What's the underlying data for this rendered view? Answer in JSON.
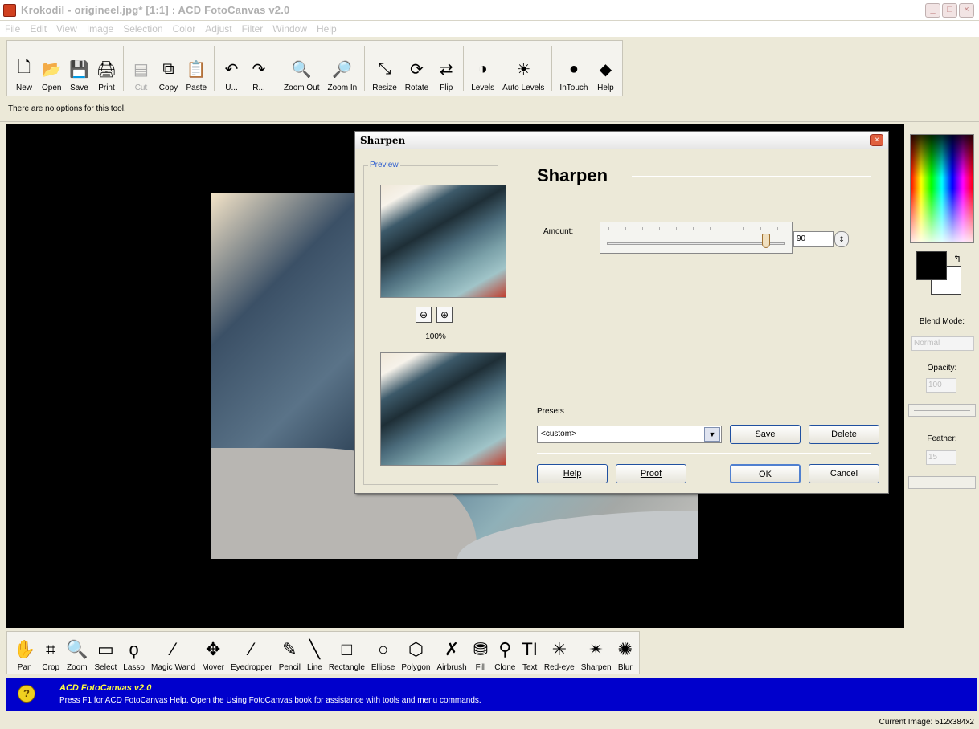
{
  "window": {
    "title": "Krokodil - origineel.jpg* [1:1] : ACD FotoCanvas v2.0",
    "buttons": [
      "_",
      "□",
      "×"
    ]
  },
  "menu": [
    "File",
    "Edit",
    "View",
    "Image",
    "Selection",
    "Color",
    "Adjust",
    "Filter",
    "Window",
    "Help"
  ],
  "toolbar": {
    "groups": [
      [
        {
          "label": "New",
          "icon": "new-file-icon",
          "glyph": "🗋",
          "disabled": false
        },
        {
          "label": "Open",
          "icon": "open-folder-icon",
          "glyph": "📂",
          "disabled": false
        },
        {
          "label": "Save",
          "icon": "save-disk-icon",
          "glyph": "💾",
          "disabled": false
        },
        {
          "label": "Print",
          "icon": "printer-icon",
          "glyph": "🖨",
          "disabled": false
        }
      ],
      [
        {
          "label": "Cut",
          "icon": "cut-icon",
          "glyph": "▤",
          "disabled": true
        },
        {
          "label": "Copy",
          "icon": "copy-icon",
          "glyph": "⧉",
          "disabled": false
        },
        {
          "label": "Paste",
          "icon": "paste-icon",
          "glyph": "📋",
          "disabled": false
        }
      ],
      [
        {
          "label": "U...",
          "icon": "undo-icon",
          "glyph": "↶",
          "disabled": false
        },
        {
          "label": "R...",
          "icon": "redo-icon",
          "glyph": "↷",
          "disabled": false
        }
      ],
      [
        {
          "label": "Zoom Out",
          "icon": "zoom-out-icon",
          "glyph": "🔍",
          "disabled": false
        },
        {
          "label": "Zoom In",
          "icon": "zoom-in-icon",
          "glyph": "🔎",
          "disabled": false
        }
      ],
      [
        {
          "label": "Resize",
          "icon": "resize-icon",
          "glyph": "⤡",
          "disabled": false
        },
        {
          "label": "Rotate",
          "icon": "rotate-icon",
          "glyph": "⟳",
          "disabled": false
        },
        {
          "label": "Flip",
          "icon": "flip-icon",
          "glyph": "⇄",
          "disabled": false
        }
      ],
      [
        {
          "label": "Levels",
          "icon": "levels-icon",
          "glyph": "◑",
          "disabled": false
        },
        {
          "label": "Auto Levels",
          "icon": "auto-levels-icon",
          "glyph": "☀",
          "disabled": false
        }
      ],
      [
        {
          "label": "InTouch",
          "icon": "intouch-icon",
          "glyph": "●",
          "disabled": false
        },
        {
          "label": "Help",
          "icon": "help-icon",
          "glyph": "◆",
          "disabled": false
        }
      ]
    ]
  },
  "options_text": "There are no options for this tool.",
  "right_panel": {
    "blend_mode_label": "Blend Mode:",
    "blend_mode_value": "Normal",
    "opacity_label": "Opacity:",
    "opacity_value": "100",
    "feather_label": "Feather:",
    "feather_value": "15"
  },
  "tools": [
    {
      "label": "Pan",
      "icon": "hand-pan-icon",
      "glyph": "✋"
    },
    {
      "label": "Crop",
      "icon": "crop-icon",
      "glyph": "⌗"
    },
    {
      "label": "Zoom",
      "icon": "zoom-tool-icon",
      "glyph": "🔍"
    },
    {
      "label": "Select",
      "icon": "select-rectangle-icon",
      "glyph": "▭"
    },
    {
      "label": "Lasso",
      "icon": "lasso-icon",
      "glyph": "ϙ"
    },
    {
      "label": "Magic Wand",
      "icon": "magic-wand-icon",
      "glyph": "⁄"
    },
    {
      "label": "Mover",
      "icon": "mover-arrows-icon",
      "glyph": "✥"
    },
    {
      "label": "Eyedropper",
      "icon": "eyedropper-icon",
      "glyph": "⁄"
    },
    {
      "label": "Pencil",
      "icon": "pencil-icon",
      "glyph": "✎"
    },
    {
      "label": "Line",
      "icon": "line-icon",
      "glyph": "╲"
    },
    {
      "label": "Rectangle",
      "icon": "rectangle-icon",
      "glyph": "□"
    },
    {
      "label": "Ellipse",
      "icon": "ellipse-icon",
      "glyph": "○"
    },
    {
      "label": "Polygon",
      "icon": "polygon-icon",
      "glyph": "⬡"
    },
    {
      "label": "Airbrush",
      "icon": "airbrush-icon",
      "glyph": "✗"
    },
    {
      "label": "Fill",
      "icon": "fill-bucket-icon",
      "glyph": "⛃"
    },
    {
      "label": "Clone",
      "icon": "clone-stamp-icon",
      "glyph": "⚲"
    },
    {
      "label": "Text",
      "icon": "text-tool-icon",
      "glyph": "TI"
    },
    {
      "label": "Red-eye",
      "icon": "red-eye-icon",
      "glyph": "✳"
    },
    {
      "label": "Sharpen",
      "icon": "sharpen-icon",
      "glyph": "✴"
    },
    {
      "label": "Blur",
      "icon": "blur-icon",
      "glyph": "✺"
    }
  ],
  "help_bar": {
    "title": "ACD FotoCanvas v2.0",
    "text": "Press F1 for ACD FotoCanvas Help.  Open the Using FotoCanvas book for assistance with tools and menu commands."
  },
  "status": {
    "current_image": "Current Image: 512x384x2"
  },
  "dialog": {
    "title": "Sharpen",
    "close": "×",
    "preview_label": "Preview",
    "zoom_out_glyph": "⊖",
    "zoom_in_glyph": "⊕",
    "zoom_percent": "100%",
    "heading": "Sharpen",
    "amount_label": "Amount:",
    "amount_value": "90",
    "amount_fraction": 0.9,
    "spin_glyph": "⇕",
    "presets_label": "Presets",
    "preset_value": "<custom>",
    "dropdown_glyph": "▼",
    "buttons": {
      "save": "Save",
      "delete": "Delete",
      "help": "Help",
      "proof": "Proof",
      "ok": "OK",
      "cancel": "Cancel"
    }
  }
}
